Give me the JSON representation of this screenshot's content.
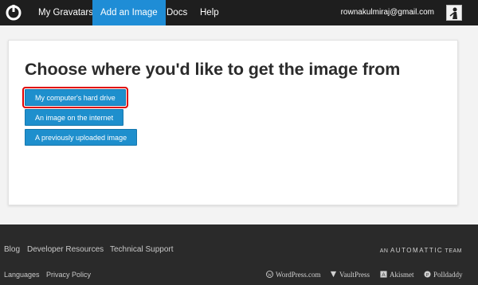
{
  "nav": {
    "items": [
      "My Gravatars",
      "Add an Image",
      "Docs",
      "Help"
    ],
    "active_index": 1,
    "email": "rownakulmiraj@gmail.com"
  },
  "main": {
    "title": "Choose where you'd like to get the image from",
    "options": [
      "My computer's hard drive",
      "An image on the internet",
      "A previously uploaded image"
    ],
    "highlighted_option_index": 0
  },
  "footer": {
    "links_row1": [
      "Blog",
      "Developer Resources",
      "Technical Support"
    ],
    "links_row2": [
      "Languages",
      "Privacy Policy"
    ],
    "automattic_prefix": "AN",
    "automattic_name": "AUTOMATTIC",
    "automattic_suffix": "TEAM",
    "sister_sites": [
      "WordPress.com",
      "VaultPress",
      "Akismet",
      "Polldaddy"
    ]
  },
  "colors": {
    "topbar": "#1e1e1e",
    "accent": "#1f8dd6",
    "highlight": "#e00000",
    "footer": "#2a2a2a"
  }
}
